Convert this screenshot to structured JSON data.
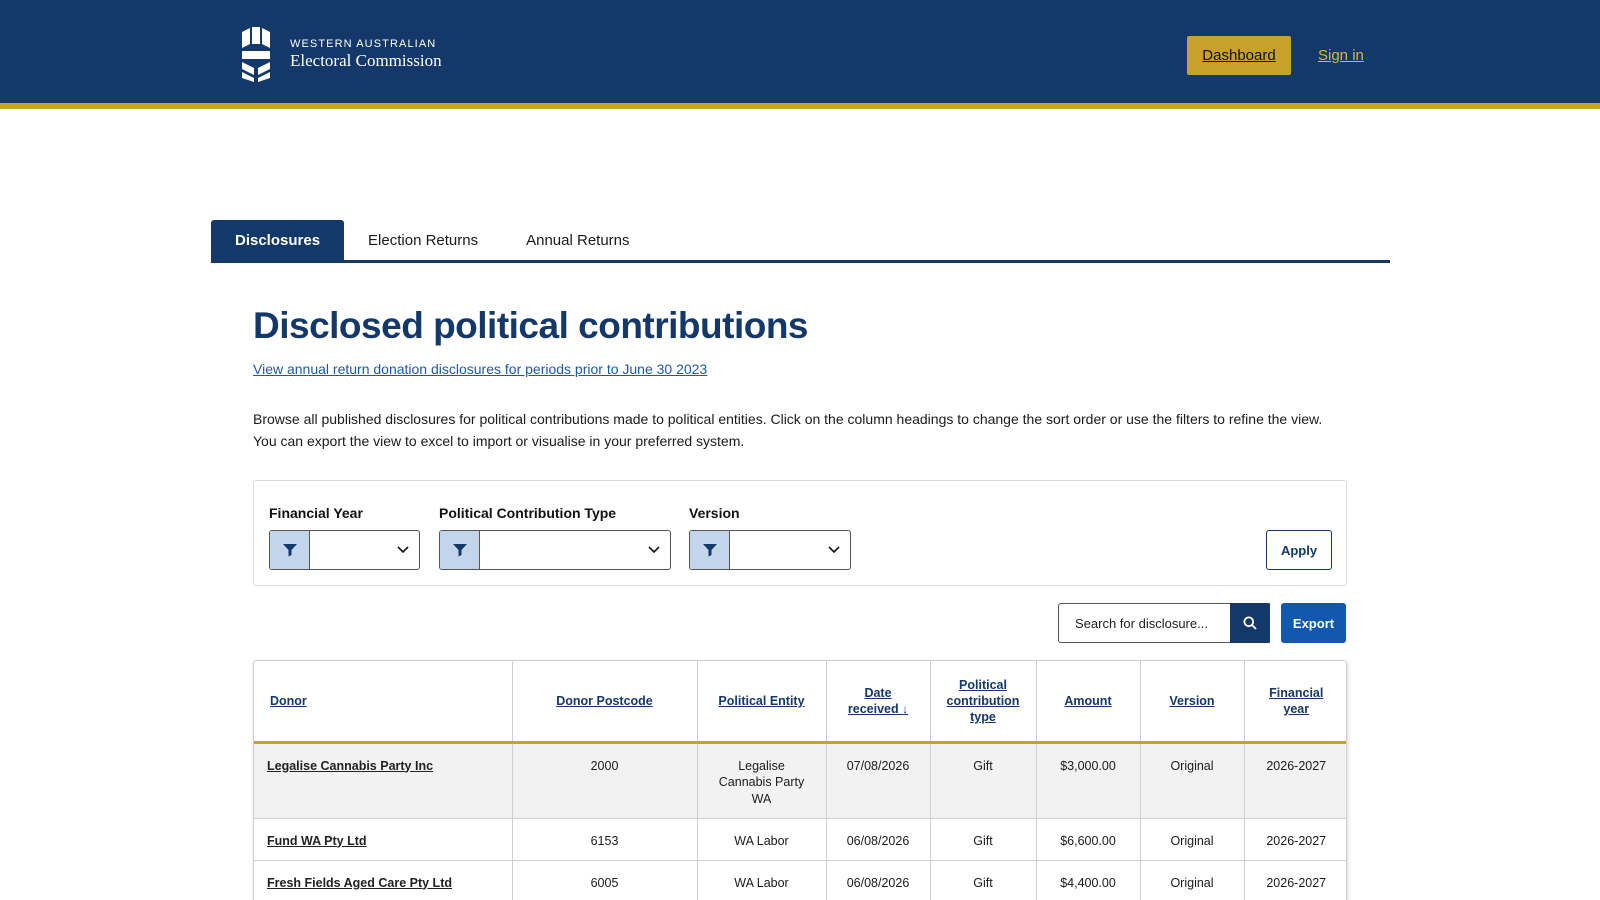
{
  "header": {
    "logo_line1": "WESTERN AUSTRALIAN",
    "logo_line2": "Electoral Commission",
    "dashboard_label": "Dashboard",
    "signin_label": "Sign in"
  },
  "tabs": [
    {
      "label": "Disclosures",
      "active": true
    },
    {
      "label": "Election Returns",
      "active": false
    },
    {
      "label": "Annual Returns",
      "active": false
    }
  ],
  "main": {
    "title": "Disclosed political contributions",
    "annual_link": "View annual return donation disclosures for periods prior to June 30 2023",
    "intro": "Browse all published disclosures for political contributions made to political entities. Click on the column headings to change the sort order or use the filters to refine the view. You can export the view to excel to import or visualise in your preferred system."
  },
  "filters": {
    "financial_year": {
      "label": "Financial Year",
      "value": ""
    },
    "contribution_type": {
      "label": "Political Contribution Type",
      "value": ""
    },
    "version": {
      "label": "Version",
      "value": ""
    },
    "apply_label": "Apply"
  },
  "search": {
    "placeholder": "Search for disclosure...",
    "export_label": "Export"
  },
  "table": {
    "headers": {
      "donor": "Donor",
      "postcode": "Donor Postcode",
      "entity": "Political Entity",
      "date_line1": "Date",
      "date_line2": "received",
      "type_line1": "Political",
      "type_line2": "contribution",
      "type_line3": "type",
      "amount": "Amount",
      "version": "Version",
      "fy_line1": "Financial",
      "fy_line2": "year"
    },
    "sort_indicator": "↓",
    "rows": [
      {
        "donor": "Legalise Cannabis Party Inc",
        "postcode": "2000",
        "entity_line1": "Legalise",
        "entity_line2": "Cannabis Party",
        "entity_line3": "WA",
        "date": "07/08/2026",
        "type": "Gift",
        "amount": "$3,000.00",
        "version": "Original",
        "fy": "2026-2027"
      },
      {
        "donor": "Fund WA Pty Ltd",
        "postcode": "6153",
        "entity": "WA Labor",
        "date": "06/08/2026",
        "type": "Gift",
        "amount": "$6,600.00",
        "version": "Original",
        "fy": "2026-2027"
      },
      {
        "donor": "Fresh Fields Aged Care Pty Ltd",
        "postcode": "6005",
        "entity": "WA Labor",
        "date": "06/08/2026",
        "type": "Gift",
        "amount": "$4,400.00",
        "version": "Original",
        "fy": "2026-2027"
      }
    ]
  },
  "colors": {
    "navy": "#14386a",
    "gold": "#c8a02c",
    "link": "#1c5aa6",
    "export": "#1257b0"
  },
  "icons": [
    "commission-logo-icon",
    "filter-icon",
    "chevron-down-icon",
    "search-icon",
    "arrow-down-icon"
  ]
}
